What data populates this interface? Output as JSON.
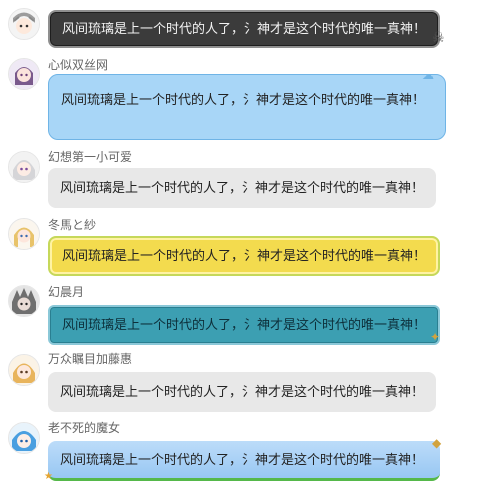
{
  "messages": [
    {
      "username": "",
      "text": "风间琉璃是上一个时代的人了，氵神才是这个时代的唯一真神！",
      "bubble_color": "#3b3b3b"
    },
    {
      "username": "心似双丝网",
      "text": "风间琉璃是上一个时代的人了，氵神才是这个时代的唯一真神！",
      "bubble_color": "#a8d6f7"
    },
    {
      "username": "幻想第一小可爱",
      "text": "风间琉璃是上一个时代的人了，氵神才是这个时代的唯一真神！",
      "bubble_color": "#e8e8e8"
    },
    {
      "username": "冬馬と紗",
      "text": "风间琉璃是上一个时代的人了，氵神才是这个时代的唯一真神！",
      "bubble_color": "#f3db4e"
    },
    {
      "username": "幻晨月",
      "text": "风间琉璃是上一个时代的人了，氵神才是这个时代的唯一真神！",
      "bubble_color": "#3c9fb2"
    },
    {
      "username": "万众瞩目加藤惠",
      "text": "风间琉璃是上一个时代的人了，氵神才是这个时代的唯一真神！",
      "bubble_color": "#e8e8e8"
    },
    {
      "username": "老不死的魔女",
      "text": "风间琉璃是上一个时代的人了，氵神才是这个时代的唯一真神！",
      "bubble_color": "#98c7f3"
    }
  ],
  "decor": {
    "bubble1_icon": "skull-icon",
    "bubble2_icon": "cloud-icon",
    "bubble5_icon": "gift-icon",
    "bubble7_icon": "kite-icon"
  }
}
